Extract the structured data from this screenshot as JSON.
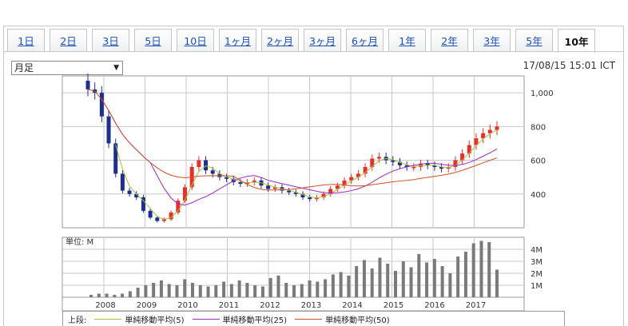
{
  "tabs": [
    {
      "label": "1日"
    },
    {
      "label": "2日"
    },
    {
      "label": "3日"
    },
    {
      "label": "5日"
    },
    {
      "label": "10日"
    },
    {
      "label": "1ヶ月"
    },
    {
      "label": "2ヶ月"
    },
    {
      "label": "3ヶ月"
    },
    {
      "label": "6ヶ月"
    },
    {
      "label": "1年"
    },
    {
      "label": "2年"
    },
    {
      "label": "3年"
    },
    {
      "label": "5年"
    },
    {
      "label": "10年"
    }
  ],
  "active_tab": "10年",
  "interval_select": {
    "value": "月足"
  },
  "timestamp": "17/08/15 15:01 ICT",
  "volume_unit_label": "単位: M",
  "legend": {
    "prefix": "上段:",
    "items": [
      {
        "label": "単純移動平均(5)",
        "color": "#a8c040"
      },
      {
        "label": "単純移動平均(25)",
        "color": "#9a2bc4"
      },
      {
        "label": "単純移動平均(50)",
        "color": "#d0502a"
      }
    ]
  },
  "colors": {
    "up": "#e8302a",
    "down": "#1c2f8c",
    "volume": "#7a7a7a",
    "grid": "#c8c8c8"
  },
  "chart_data": [
    {
      "type": "candlestick",
      "title": "",
      "x_tick_labels": [
        "2008",
        "2009",
        "2010",
        "2011",
        "2012",
        "2013",
        "2014",
        "2015",
        "2016",
        "2017"
      ],
      "y_tick_labels": [
        "1,000",
        "800",
        "600",
        "400"
      ],
      "ylim": [
        200,
        1100
      ],
      "series": [
        {
          "name": "単純移動平均(5)",
          "values": []
        },
        {
          "name": "単純移動平均(25)",
          "values": []
        },
        {
          "name": "単純移動平均(50)",
          "values": []
        }
      ],
      "ohlc_close": [
        1020,
        1000,
        860,
        700,
        520,
        420,
        400,
        380,
        300,
        260,
        240,
        250,
        290,
        360,
        440,
        560,
        600,
        540,
        520,
        500,
        490,
        470,
        460,
        470,
        480,
        450,
        430,
        440,
        420,
        410,
        400,
        380,
        370,
        380,
        400,
        430,
        450,
        480,
        500,
        520,
        560,
        610,
        620,
        600,
        590,
        570,
        560,
        560,
        580,
        570,
        560,
        550,
        560,
        600,
        640,
        690,
        730,
        760,
        780,
        800
      ]
    },
    {
      "type": "bar",
      "title": "",
      "y_tick_labels": [
        "4M",
        "3M",
        "2M",
        "1M"
      ],
      "ylim": [
        0,
        5
      ],
      "values": [
        0.2,
        0.3,
        0.3,
        0.2,
        0.3,
        0.5,
        0.8,
        1.0,
        1.2,
        1.4,
        1.1,
        1.0,
        1.5,
        1.2,
        1.0,
        0.9,
        1.0,
        1.3,
        1.1,
        1.4,
        1.2,
        1.0,
        0.9,
        1.6,
        1.8,
        1.2,
        1.0,
        1.1,
        1.4,
        1.3,
        1.5,
        1.9,
        2.1,
        1.8,
        2.6,
        3.1,
        2.4,
        3.3,
        2.8,
        2.2,
        3.0,
        2.5,
        3.6,
        2.9,
        3.2,
        2.6,
        2.0,
        3.4,
        3.8,
        4.5,
        4.7,
        4.6,
        2.3
      ]
    }
  ]
}
